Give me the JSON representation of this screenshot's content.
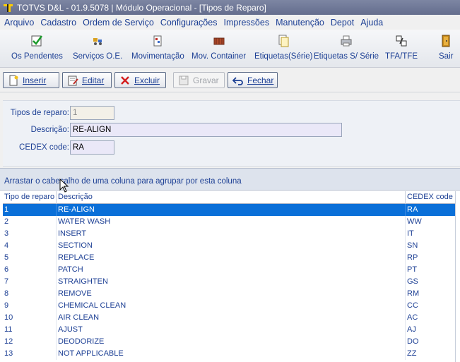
{
  "window": {
    "title": "TOTVS D&L - 01.9.5078 | Módulo Operacional - [Tipos de Reparo]"
  },
  "menu": [
    "Arquivo",
    "Cadastro",
    "Ordem de Serviço",
    "Configurações",
    "Impressões",
    "Manutenção",
    "Depot",
    "Ajuda"
  ],
  "toolbar": {
    "os_pendentes": "Os Pendentes",
    "servicos_oe": "Serviços O.E.",
    "movimentacao": "Movimentação",
    "mov_container": "Mov. Container",
    "etiquetas_serie": "Etiquetas(Série)",
    "etiquetas_s_serie": "Etiquetas S/ Série",
    "tfa_tfe": "TFA/TFE",
    "sair": "Sair"
  },
  "actions": {
    "inserir": "Inserir",
    "editar": "Editar",
    "excluir": "Excluir",
    "gravar": "Gravar",
    "fechar": "Fechar"
  },
  "form": {
    "tipo_label": "Tipos de reparo:",
    "tipo_value": "1",
    "descricao_label": "Descrição:",
    "descricao_value": "RE-ALIGN",
    "cedex_label": "CEDEX code:",
    "cedex_value": "RA"
  },
  "grid": {
    "group_hint": "Arrastar o cabeçalho de uma coluna para agrupar por esta coluna",
    "columns": [
      "Tipo de reparo",
      "Descrição",
      "CEDEX code"
    ],
    "rows": [
      [
        "1",
        "RE-ALIGN",
        "RA"
      ],
      [
        "2",
        "WATER WASH",
        "WW"
      ],
      [
        "3",
        "INSERT",
        "IT"
      ],
      [
        "4",
        "SECTION",
        "SN"
      ],
      [
        "5",
        "REPLACE",
        "RP"
      ],
      [
        "6",
        "PATCH",
        "PT"
      ],
      [
        "7",
        "STRAIGHTEN",
        "GS"
      ],
      [
        "8",
        "REMOVE",
        "RM"
      ],
      [
        "9",
        "CHEMICAL CLEAN",
        "CC"
      ],
      [
        "10",
        "AIR CLEAN",
        "AC"
      ],
      [
        "11",
        "AJUST",
        "AJ"
      ],
      [
        "12",
        "DEODORIZE",
        "DO"
      ],
      [
        "13",
        "NOT APPLICABLE",
        "ZZ"
      ]
    ],
    "selected_row": 0
  },
  "colors": {
    "accent": "#1c3f94",
    "selection": "#0a6fd8",
    "titlebar": "#6f7896"
  }
}
